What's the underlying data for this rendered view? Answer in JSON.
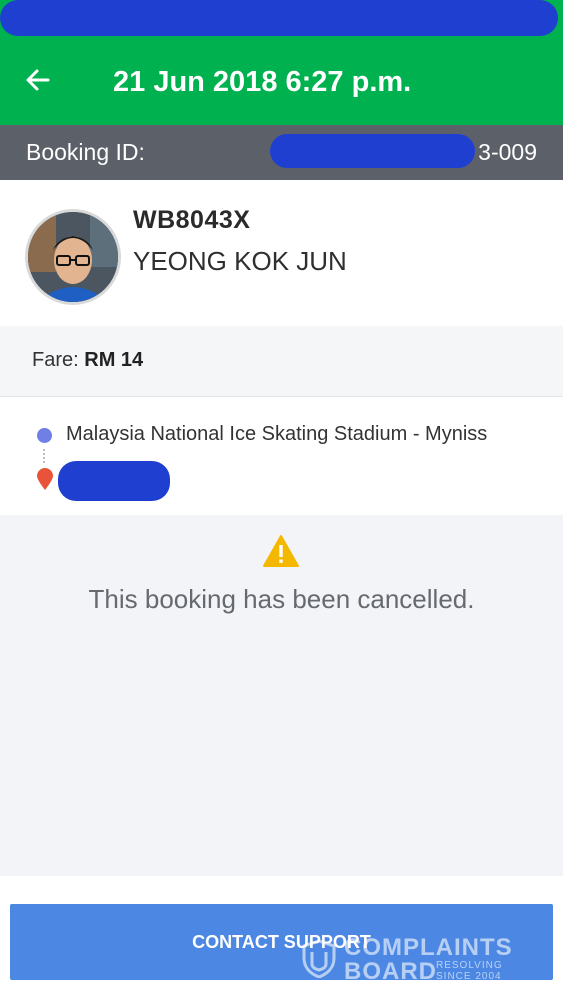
{
  "header": {
    "title": "21 Jun 2018 6:27 p.m.",
    "back_icon": "arrow-left-icon"
  },
  "booking": {
    "label": "Booking ID:",
    "visible_suffix": "3-009"
  },
  "driver": {
    "plate": "WB8043X",
    "name": "YEONG KOK JUN"
  },
  "fare": {
    "label": "Fare:",
    "value": "RM 14"
  },
  "route": {
    "pickup": "Malaysia National Ice Skating Stadium - Myniss"
  },
  "status": {
    "message": "This booking has been cancelled.",
    "icon": "warning-icon"
  },
  "support": {
    "button_label": "CONTACT SUPPORT"
  },
  "watermark": {
    "line1": "COMPLAINTS",
    "line2": "BOARD",
    "sub1": "RESOLVING",
    "sub2": "SINCE 2004"
  },
  "colors": {
    "brand_green": "#00b14f",
    "booking_bar": "#5c6068",
    "button_blue": "#4c88e3",
    "warning": "#f5b800",
    "dropoff_pin": "#e8533a",
    "pickup_dot": "#6f7fe6",
    "redaction": "#1f3fd1"
  }
}
